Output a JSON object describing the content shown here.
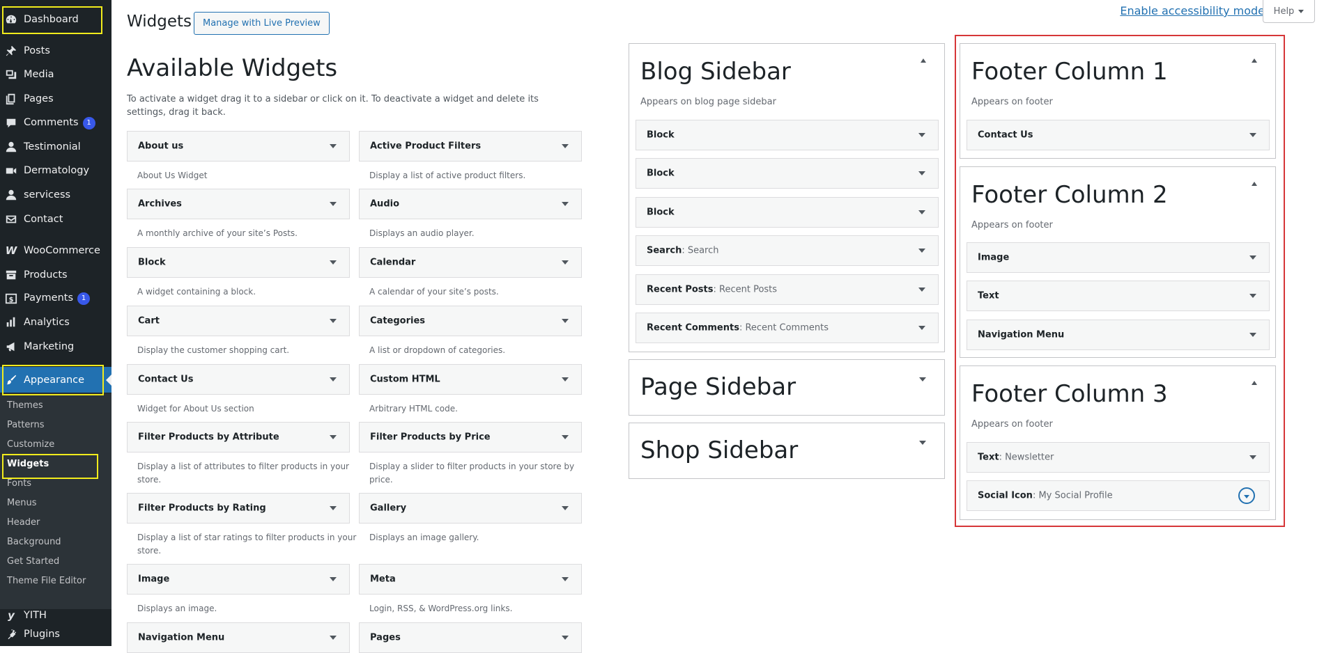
{
  "sidebar": {
    "items": [
      {
        "label": "Dashboard",
        "icon": "dashboard-icon"
      },
      {
        "label": "Posts",
        "icon": "pin-icon"
      },
      {
        "label": "Media",
        "icon": "media-icon"
      },
      {
        "label": "Pages",
        "icon": "pages-icon"
      },
      {
        "label": "Comments",
        "icon": "comment-icon",
        "badge": "1"
      },
      {
        "label": "Testimonial",
        "icon": "user-icon"
      },
      {
        "label": "Dermatology",
        "icon": "video-icon"
      },
      {
        "label": "servicess",
        "icon": "user-icon"
      },
      {
        "label": "Contact",
        "icon": "mail-icon"
      },
      {
        "label": "WooCommerce",
        "icon": "woo-icon"
      },
      {
        "label": "Products",
        "icon": "archive-icon"
      },
      {
        "label": "Payments",
        "icon": "dollar-icon",
        "badge": "1"
      },
      {
        "label": "Analytics",
        "icon": "bar-chart-icon"
      },
      {
        "label": "Marketing",
        "icon": "megaphone-icon"
      },
      {
        "label": "Appearance",
        "icon": "brush-icon"
      },
      {
        "label": "YITH",
        "icon": "yith-icon"
      },
      {
        "label": "Plugins",
        "icon": "plug-icon"
      }
    ],
    "submenu": [
      "Themes",
      "Patterns",
      "Customize",
      "Widgets",
      "Fonts",
      "Menus",
      "Header",
      "Background",
      "Get Started",
      "Theme File Editor"
    ]
  },
  "header": {
    "title": "Widgets",
    "live_preview": "Manage with Live Preview",
    "accessibility": "Enable accessibility mode",
    "help": "Help"
  },
  "available": {
    "title": "Available Widgets",
    "description": "To activate a widget drag it to a sidebar or click on it. To deactivate a widget and delete its settings, drag it back.",
    "widgets": [
      {
        "name": "About us",
        "desc": "About Us Widget"
      },
      {
        "name": "Active Product Filters",
        "desc": "Display a list of active product filters."
      },
      {
        "name": "Archives",
        "desc": "A monthly archive of your site’s Posts."
      },
      {
        "name": "Audio",
        "desc": "Displays an audio player."
      },
      {
        "name": "Block",
        "desc": "A widget containing a block."
      },
      {
        "name": "Calendar",
        "desc": "A calendar of your site’s posts."
      },
      {
        "name": "Cart",
        "desc": "Display the customer shopping cart."
      },
      {
        "name": "Categories",
        "desc": "A list or dropdown of categories."
      },
      {
        "name": "Contact Us",
        "desc": "Widget for About Us section"
      },
      {
        "name": "Custom HTML",
        "desc": "Arbitrary HTML code."
      },
      {
        "name": "Filter Products by Attribute",
        "desc": "Display a list of attributes to filter products in your store."
      },
      {
        "name": "Filter Products by Price",
        "desc": "Display a slider to filter products in your store by price."
      },
      {
        "name": "Filter Products by Rating",
        "desc": "Display a list of star ratings to filter products in your store."
      },
      {
        "name": "Gallery",
        "desc": "Displays an image gallery."
      },
      {
        "name": "Image",
        "desc": "Displays an image."
      },
      {
        "name": "Meta",
        "desc": "Login, RSS, & WordPress.org links."
      },
      {
        "name": "Navigation Menu",
        "desc": ""
      },
      {
        "name": "Pages",
        "desc": ""
      }
    ]
  },
  "sidebars": {
    "blog": {
      "title": "Blog Sidebar",
      "desc": "Appears on blog page sidebar",
      "widgets": [
        {
          "name": "Block",
          "instance": ""
        },
        {
          "name": "Block",
          "instance": ""
        },
        {
          "name": "Block",
          "instance": ""
        },
        {
          "name": "Search",
          "instance": ": Search"
        },
        {
          "name": "Recent Posts",
          "instance": ": Recent Posts"
        },
        {
          "name": "Recent Comments",
          "instance": ": Recent Comments"
        }
      ]
    },
    "page": {
      "title": "Page Sidebar"
    },
    "shop": {
      "title": "Shop Sidebar"
    },
    "footer1": {
      "title": "Footer Column 1",
      "desc": "Appears on footer",
      "widgets": [
        {
          "name": "Contact Us",
          "instance": ""
        }
      ]
    },
    "footer2": {
      "title": "Footer Column 2",
      "desc": "Appears on footer",
      "widgets": [
        {
          "name": "Image",
          "instance": ""
        },
        {
          "name": "Text",
          "instance": ""
        },
        {
          "name": "Navigation Menu",
          "instance": ""
        }
      ]
    },
    "footer3": {
      "title": "Footer Column 3",
      "desc": "Appears on footer",
      "widgets": [
        {
          "name": "Text",
          "instance": ": Newsletter"
        },
        {
          "name": "Social Icon",
          "instance": ": My Social Profile"
        }
      ]
    }
  },
  "colors": {
    "admin_bg": "#1d2327",
    "accent": "#2271b1",
    "highlight_yellow": "#f2ec1c",
    "highlight_red": "#d63638"
  }
}
